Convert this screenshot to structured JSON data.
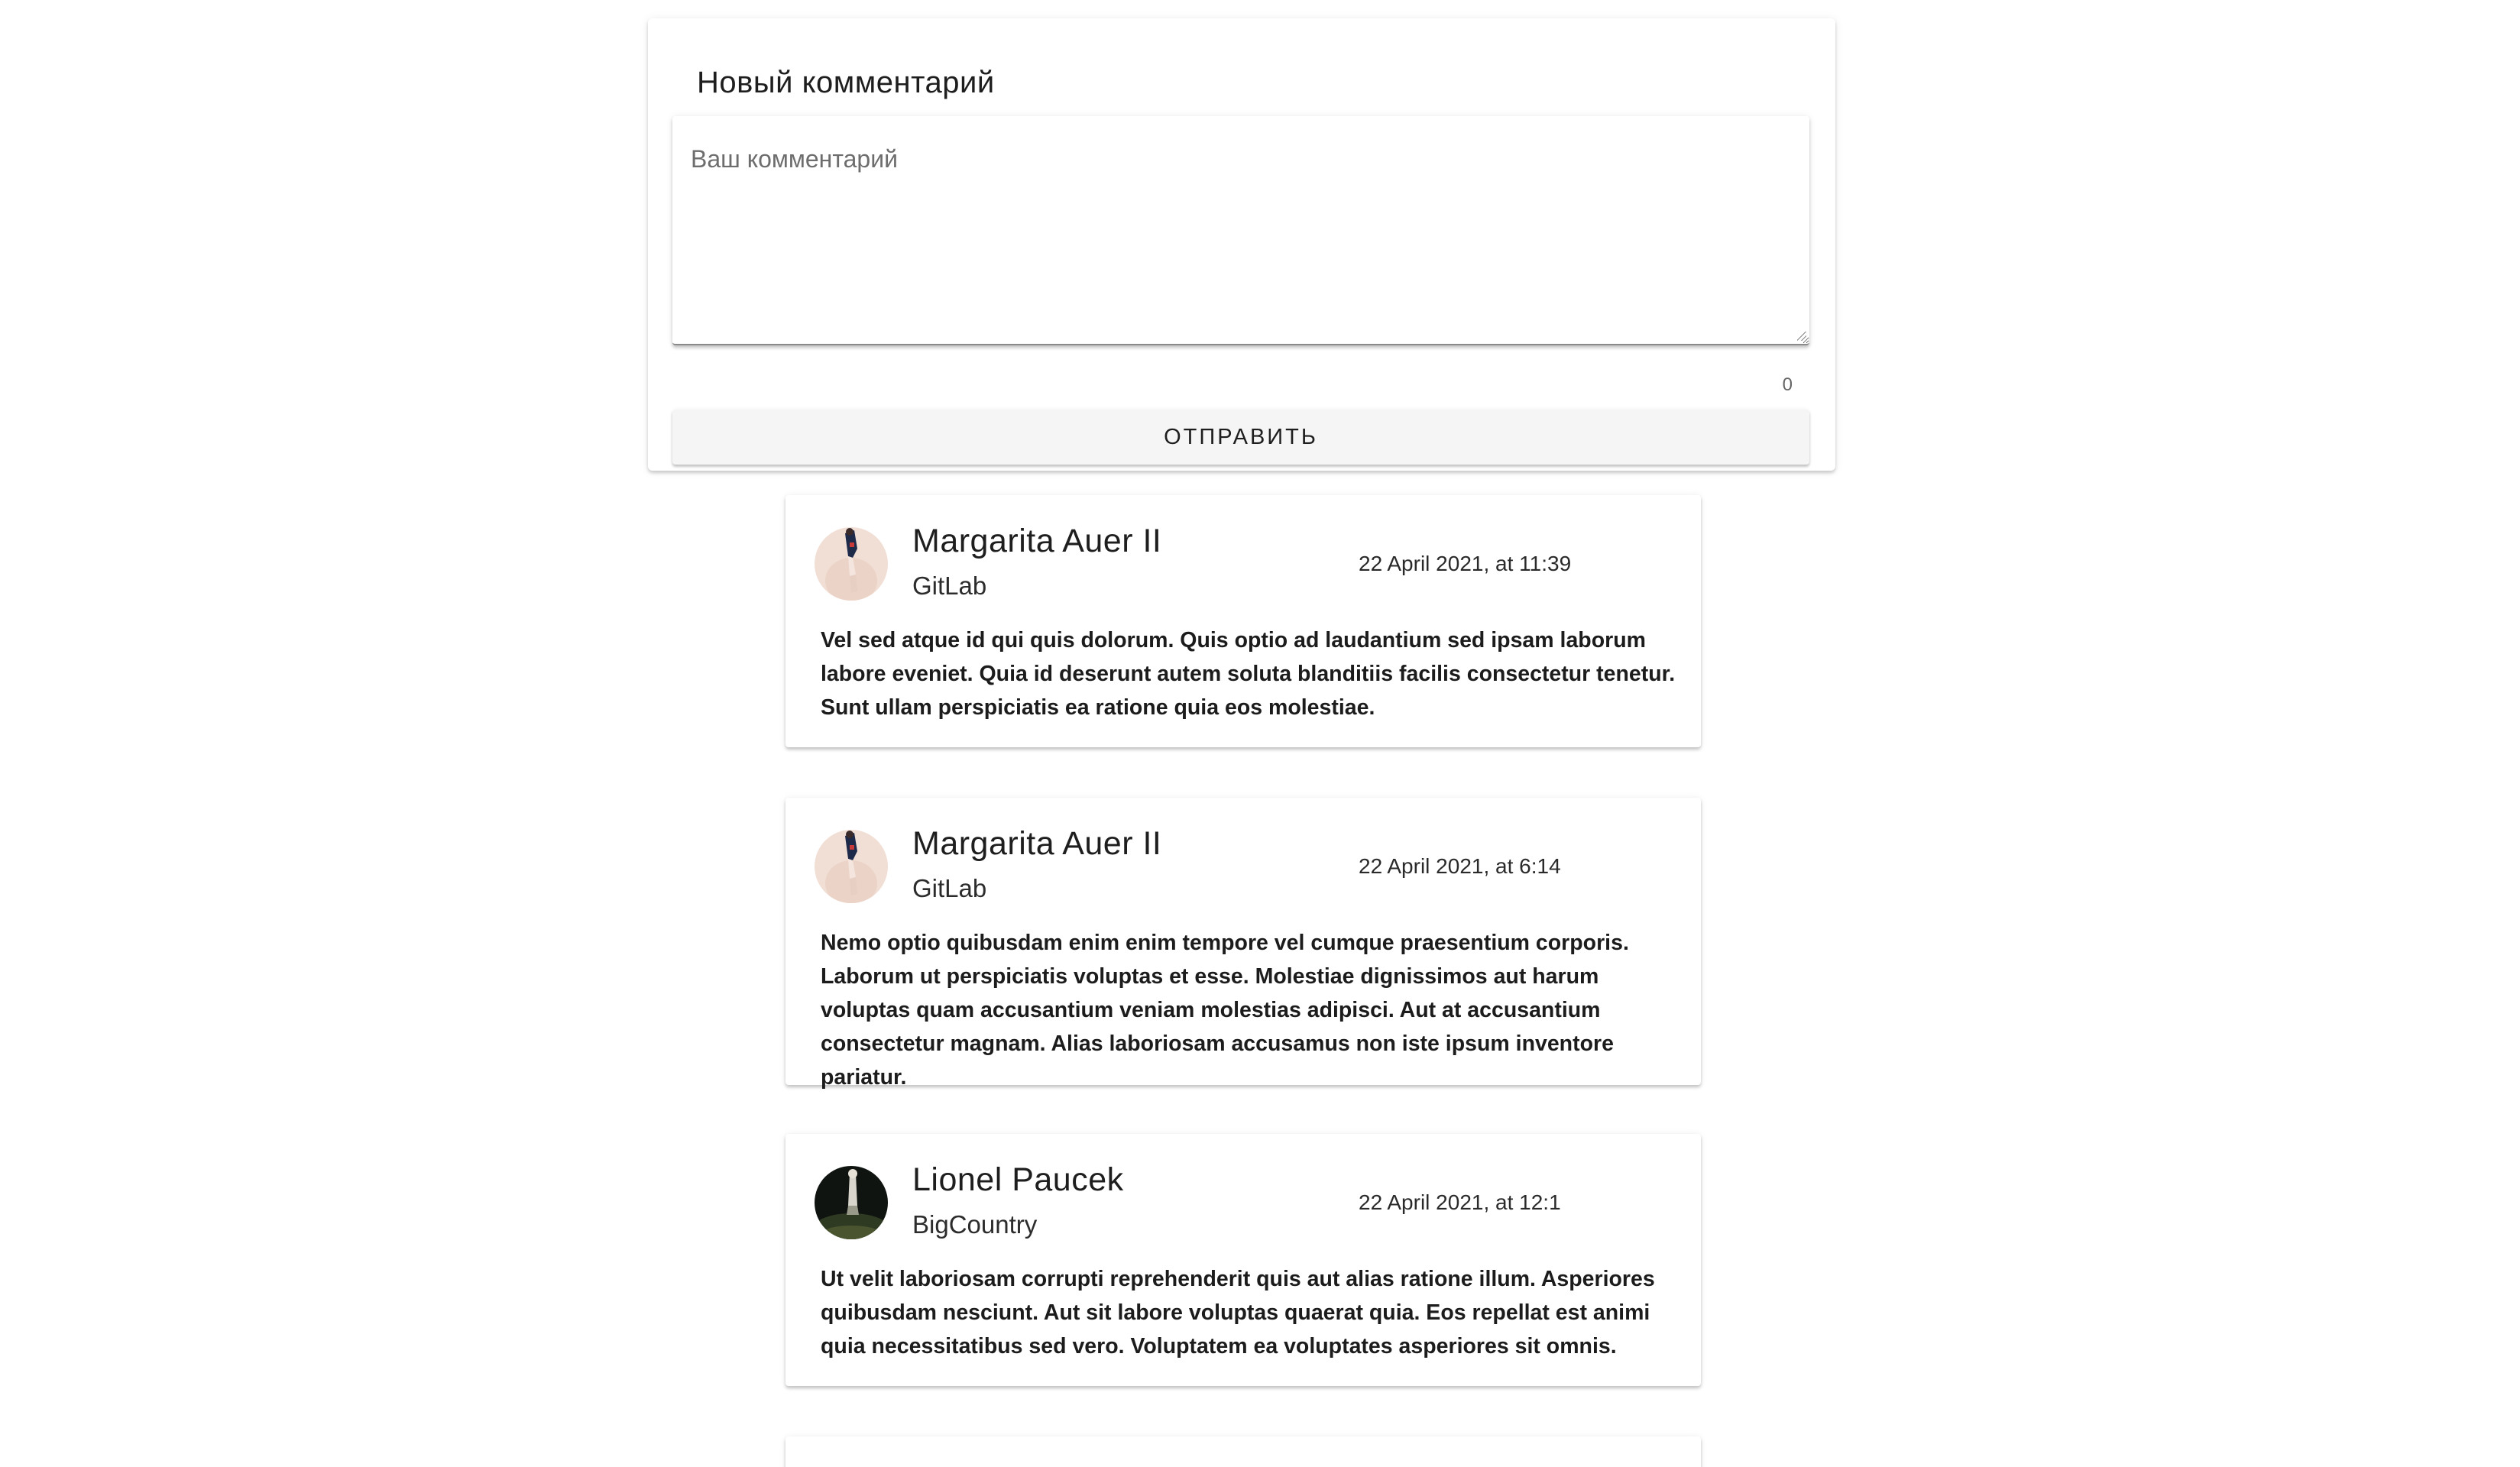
{
  "new_comment": {
    "title": "Новый комментарий",
    "textarea_placeholder": "Ваш комментарий",
    "textarea_value": "",
    "char_counter": "0",
    "submit_label": "ОТПРАВИТЬ"
  },
  "comments": [
    {
      "author": "Margarita Auer II",
      "company": "GitLab",
      "date": "22 April 2021, at 11:39",
      "text": "Vel sed atque id qui quis dolorum. Quis optio ad laudantium sed ipsam laborum labore eveniet. Quia id deserunt autem soluta blanditiis facilis consectetur tenetur. Sunt ullam perspiciatis ea ratione quia eos molestiae.",
      "avatar": "person-photo-light"
    },
    {
      "author": "Margarita Auer II",
      "company": "GitLab",
      "date": "22 April 2021, at 6:14",
      "text": "Nemo optio quibusdam enim enim tempore vel cumque praesentium corporis. Laborum ut perspiciatis voluptas et esse. Molestiae dignissimos aut harum voluptas quam accusantium veniam molestias adipisci. Aut at accusantium consectetur magnam. Alias laboriosam accusamus non iste ipsum inventore pariatur.",
      "avatar": "person-photo-light"
    },
    {
      "author": "Lionel Paucek",
      "company": "BigCountry",
      "date": "22 April 2021, at 12:1",
      "text": "Ut velit laboriosam corrupti reprehenderit quis aut alias ratione illum. Asperiores quibusdam nesciunt. Aut sit labore voluptas quaerat quia. Eos repellat est animi quia necessitatibus sed vero. Voluptatem ea voluptates asperiores sit omnis.",
      "avatar": "person-photo-dark"
    }
  ]
}
